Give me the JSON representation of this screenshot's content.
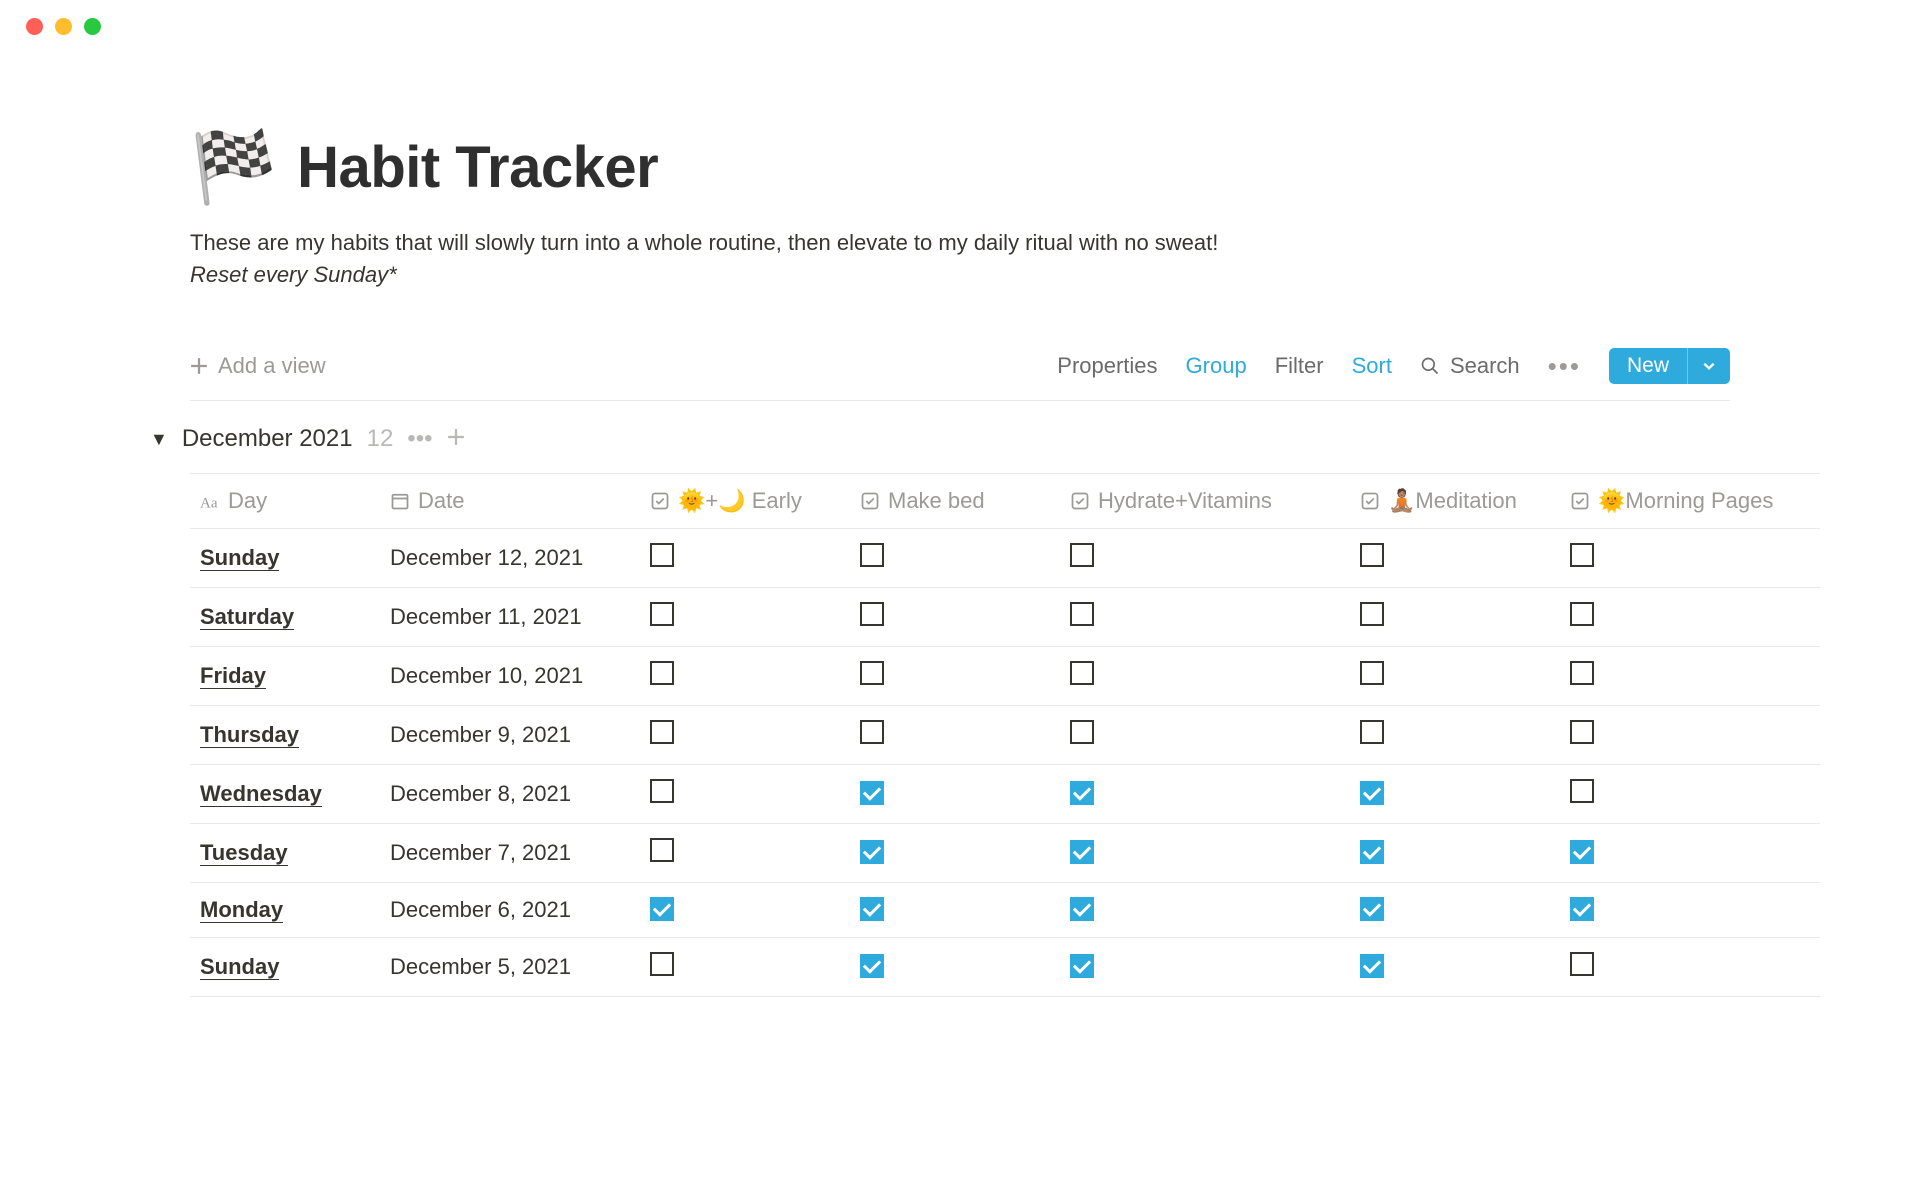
{
  "page": {
    "emoji": "🏁",
    "title": "Habit Tracker",
    "description": "These are my habits that will slowly turn into a whole routine, then elevate to my daily ritual with no sweat!",
    "note": "Reset every Sunday*"
  },
  "toolbar": {
    "add_view": "Add a view",
    "properties": "Properties",
    "group": "Group",
    "filter": "Filter",
    "sort": "Sort",
    "search": "Search",
    "new": "New"
  },
  "group": {
    "title": "December 2021",
    "count": "12"
  },
  "columns": {
    "day": "Day",
    "date": "Date",
    "early": "🌞+🌙 Early",
    "make_bed": "Make bed",
    "hydrate": "Hydrate+Vitamins",
    "meditation": "🧘🏽Meditation",
    "morning_pages": "🌞Morning Pages"
  },
  "rows": [
    {
      "day": "Sunday",
      "date": "December 12, 2021",
      "early": false,
      "make_bed": false,
      "hydrate": false,
      "meditation": false,
      "morning_pages": false
    },
    {
      "day": "Saturday",
      "date": "December 11, 2021",
      "early": false,
      "make_bed": false,
      "hydrate": false,
      "meditation": false,
      "morning_pages": false
    },
    {
      "day": "Friday",
      "date": "December 10, 2021",
      "early": false,
      "make_bed": false,
      "hydrate": false,
      "meditation": false,
      "morning_pages": false
    },
    {
      "day": "Thursday",
      "date": "December 9, 2021",
      "early": false,
      "make_bed": false,
      "hydrate": false,
      "meditation": false,
      "morning_pages": false
    },
    {
      "day": "Wednesday",
      "date": "December 8, 2021",
      "early": false,
      "make_bed": true,
      "hydrate": true,
      "meditation": true,
      "morning_pages": false
    },
    {
      "day": "Tuesday",
      "date": "December 7, 2021",
      "early": false,
      "make_bed": true,
      "hydrate": true,
      "meditation": true,
      "morning_pages": true
    },
    {
      "day": "Monday",
      "date": "December 6, 2021",
      "early": true,
      "make_bed": true,
      "hydrate": true,
      "meditation": true,
      "morning_pages": true
    },
    {
      "day": "Sunday",
      "date": "December 5, 2021",
      "early": false,
      "make_bed": true,
      "hydrate": true,
      "meditation": true,
      "morning_pages": false
    }
  ]
}
